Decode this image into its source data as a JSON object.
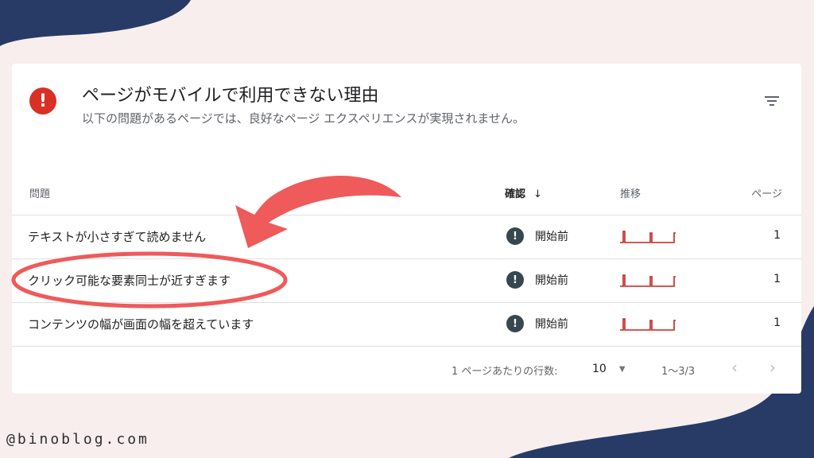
{
  "card": {
    "title": "ページがモバイルで利用できない理由",
    "subtitle": "以下の問題があるページでは、良好なページ エクスペリエンスが実現されません。",
    "alert_icon": "!",
    "filter_icon": "filter-icon"
  },
  "table": {
    "headers": {
      "issue": "問題",
      "confirm": "確認",
      "sort_arrow": "↓",
      "trend": "推移",
      "pages": "ページ"
    },
    "rows": [
      {
        "issue": "テキストが小さすぎて読めません",
        "status": "開始前",
        "status_icon": "!",
        "pages": "1"
      },
      {
        "issue": "クリック可能な要素同士が近すぎます",
        "status": "開始前",
        "status_icon": "!",
        "pages": "1"
      },
      {
        "issue": "コンテンツの幅が画面の幅を超えています",
        "status": "開始前",
        "status_icon": "!",
        "pages": "1"
      }
    ]
  },
  "footer": {
    "rows_per_page_label": "1 ページあたりの行数:",
    "rows_per_page_value": "10",
    "dropdown_caret": "▼",
    "range": "1〜3/3",
    "prev": "‹",
    "next": "›"
  },
  "watermark": "@binoblog.com",
  "colors": {
    "alert_red": "#d93025",
    "annotation_red": "#ef5a5a",
    "navy": "#273b66",
    "status_gray": "#37474f",
    "sparkline": "#c5221f"
  }
}
